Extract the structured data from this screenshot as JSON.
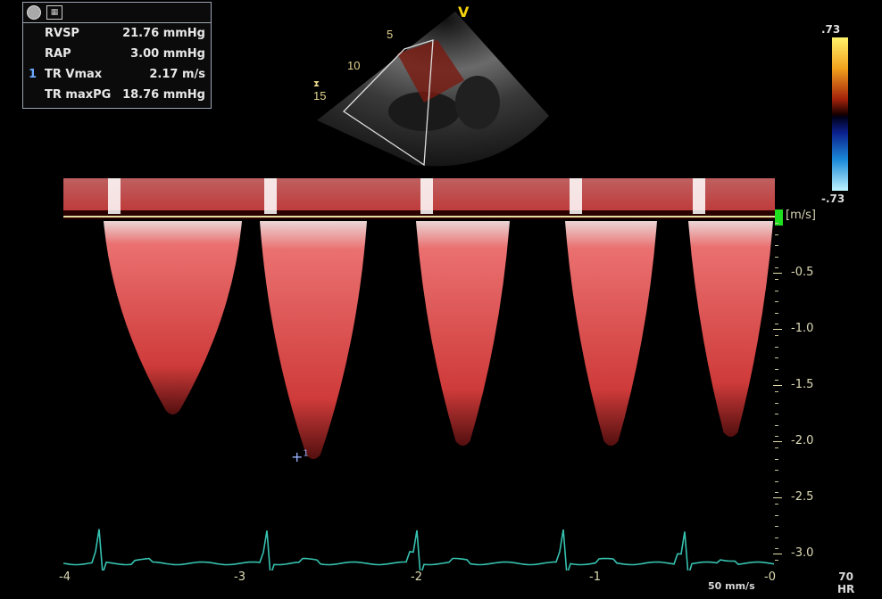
{
  "measurements": {
    "rows": [
      {
        "index": "",
        "label": "RVSP",
        "value": "21.76 mmHg"
      },
      {
        "index": "",
        "label": "RAP",
        "value": "3.00 mmHg"
      },
      {
        "index": "1",
        "label": "TR Vmax",
        "value": "2.17 m/s"
      },
      {
        "index": "",
        "label": "TR maxPG",
        "value": "18.76 mmHg"
      }
    ],
    "header_icons": [
      "record-icon",
      "calculator-icon"
    ]
  },
  "sector": {
    "depth_labels": [
      "5",
      "10",
      "15"
    ],
    "orientation_marker": "V"
  },
  "color_scale": {
    "top": ".73",
    "bottom": "-.73"
  },
  "doppler": {
    "unit": "[m/s]",
    "velocity_ticks": [
      "-0.5",
      "-1.0",
      "-1.5",
      "-2.0",
      "-2.5",
      "-3.0"
    ],
    "time_ticks": [
      "-4",
      "-3",
      "-2",
      "-1",
      "-0"
    ],
    "sweep_speed": "50 mm/s",
    "heart_rate": {
      "value": "70",
      "unit": "HR"
    },
    "measurement_cursor": "1"
  },
  "colors": {
    "spectrum": "#ff5a5a",
    "baseline": "#e6e0a0",
    "ecg": "#36c2b0",
    "axis": "#dedbb5"
  }
}
